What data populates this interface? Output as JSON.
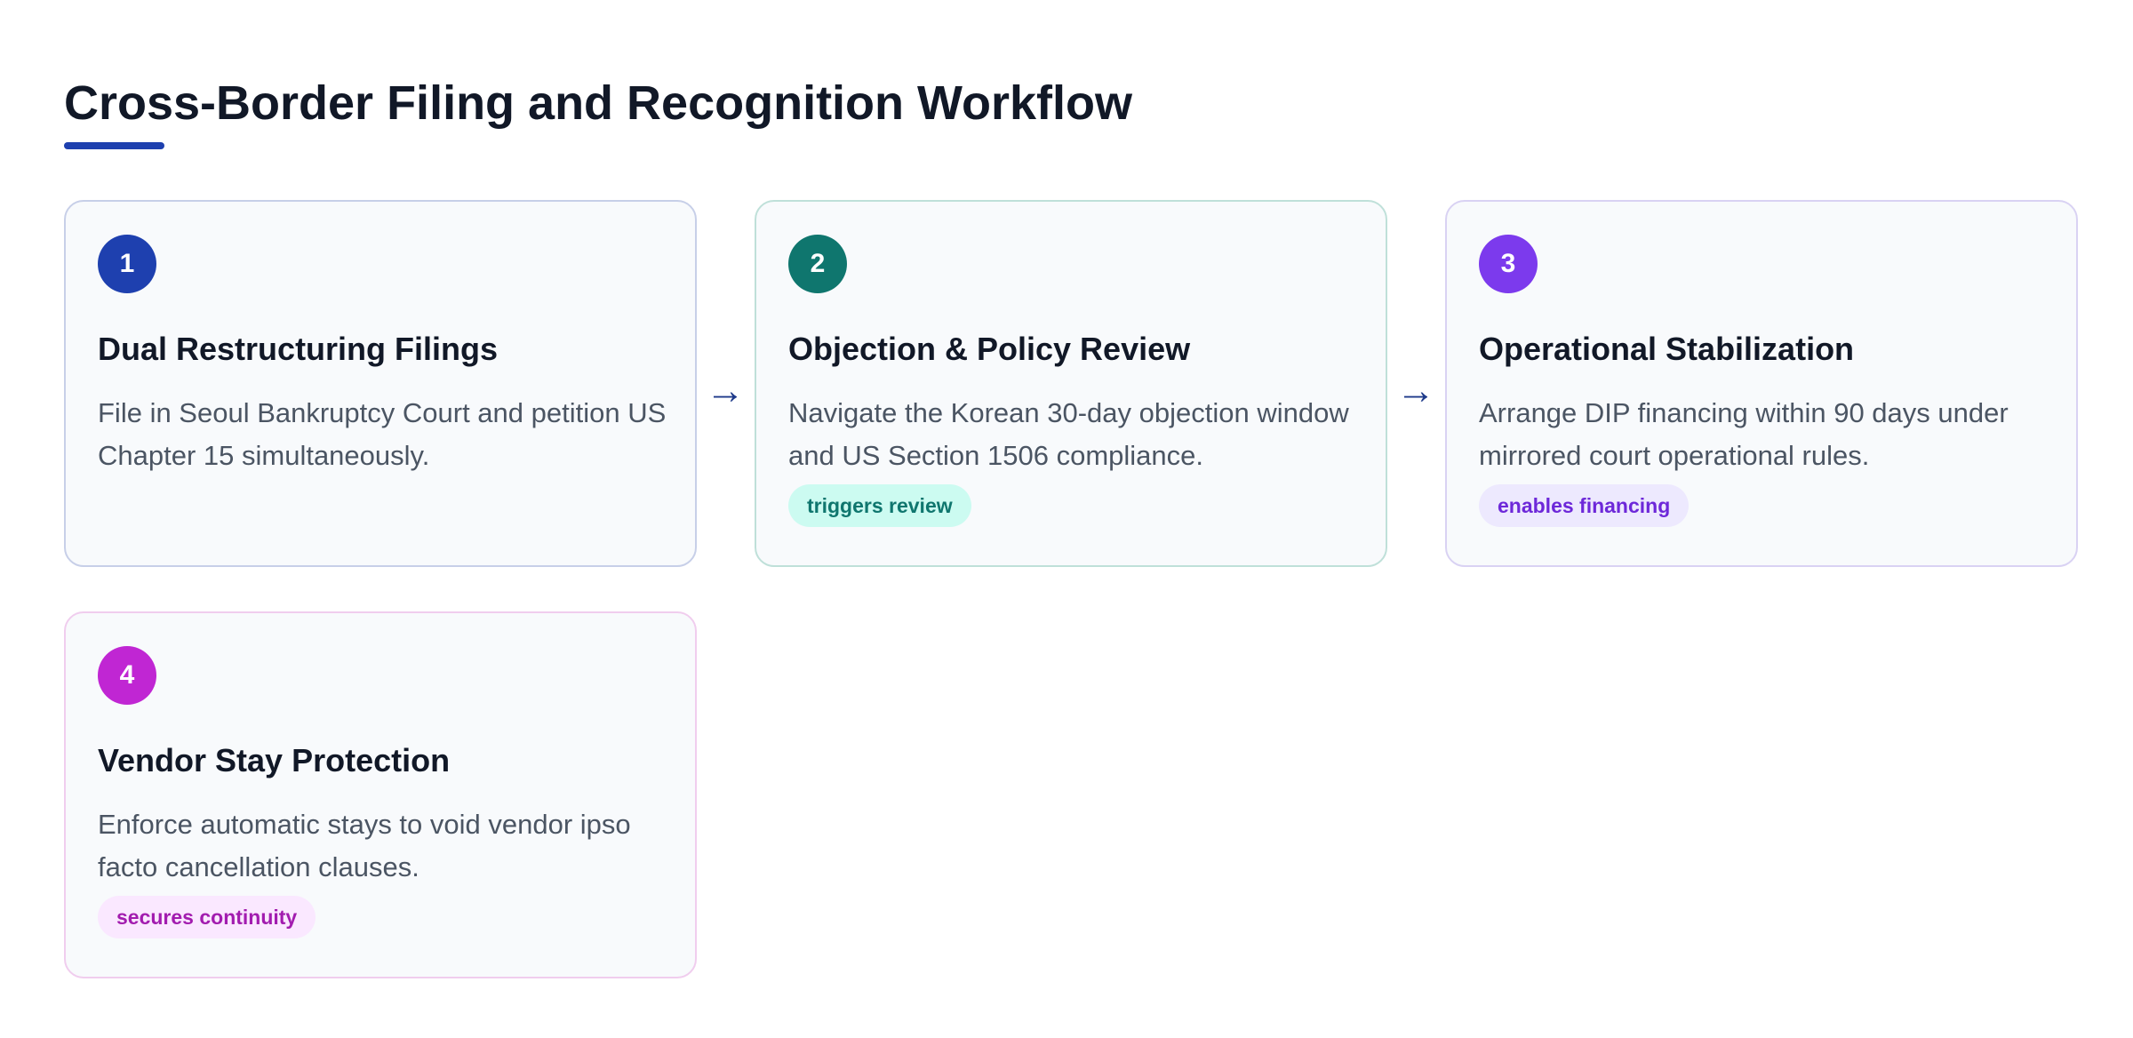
{
  "title": "Cross-Border Filing and Recognition Workflow",
  "colors": {
    "title_accent": "#1e40af",
    "arrow": "#1e3a8a"
  },
  "arrow_glyph": "→",
  "steps": [
    {
      "number": "1",
      "title": "Dual Restructuring Filings",
      "description": "File in Seoul Bankruptcy Court and petition US Chapter 15 simultaneously.",
      "tag": "",
      "badge_color": "#1e40af",
      "tag_bg": "",
      "tag_color": ""
    },
    {
      "number": "2",
      "title": "Objection & Policy Review",
      "description": "Navigate the Korean 30-day objection window and US Section 1506 compliance.",
      "tag": "triggers review",
      "badge_color": "#0f766e",
      "tag_bg": "#ccfbf1",
      "tag_color": "#0f766e"
    },
    {
      "number": "3",
      "title": "Operational Stabilization",
      "description": "Arrange DIP financing within 90 days under mirrored court operational rules.",
      "tag": "enables financing",
      "badge_color": "#7c3aed",
      "tag_bg": "#ede9fe",
      "tag_color": "#6d28d9"
    },
    {
      "number": "4",
      "title": "Vendor Stay Protection",
      "description": "Enforce automatic stays to void vendor ipso facto cancellation clauses.",
      "tag": "secures continuity",
      "badge_color": "#c026d3",
      "tag_bg": "#fae8ff",
      "tag_color": "#a21caf"
    }
  ]
}
